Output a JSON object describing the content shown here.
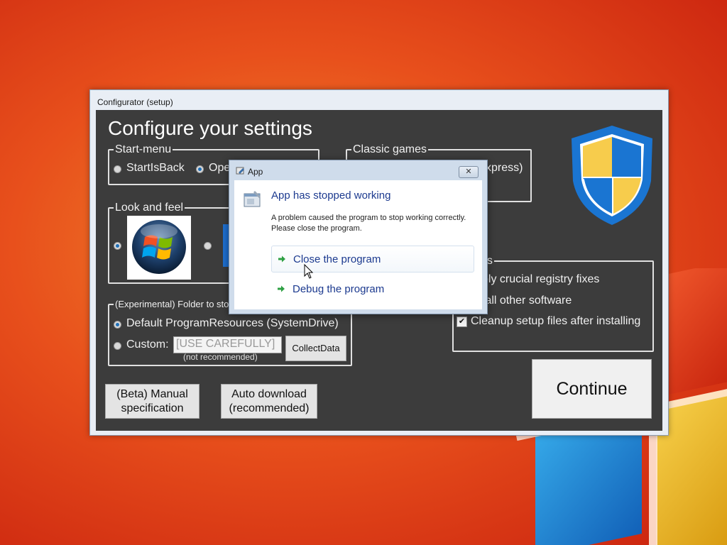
{
  "window": {
    "title": "Configurator (setup)",
    "heading": "Configure your settings"
  },
  "startmenu": {
    "label": "Start-menu",
    "options": [
      "StartIsBack",
      "Ope"
    ],
    "selected": 1
  },
  "classic_games": {
    "label": "Classic games",
    "partial_text": "xpress)"
  },
  "look_and_feel": {
    "label": "Look and feel"
  },
  "folder": {
    "label": "(Experimental) Folder to sto",
    "option_default": "Default ProgramResources (SystemDrive)",
    "option_custom": "Custom:",
    "custom_value": "[USE CAREFULLY]",
    "collect_button": "CollectData",
    "note": "(not recommended)"
  },
  "options": {
    "label_partial": "ns",
    "items": [
      "ply crucial registry fixes",
      "tall other software",
      "Cleanup setup files after installing"
    ],
    "cleanup_checked": true
  },
  "buttons": {
    "manual": "(Beta) Manual specification",
    "auto": "Auto download (recommended)",
    "continue": "Continue"
  },
  "dialog": {
    "title": "App",
    "close_glyph": "✕",
    "heading": "App has stopped working",
    "message": "A problem caused the program to stop working correctly. Please close the program.",
    "commands": [
      "Close the program",
      "Debug the program"
    ]
  },
  "colors": {
    "client_bg": "#3c3c3c",
    "link": "#1c3a8f",
    "accent_green": "#2ea043"
  }
}
